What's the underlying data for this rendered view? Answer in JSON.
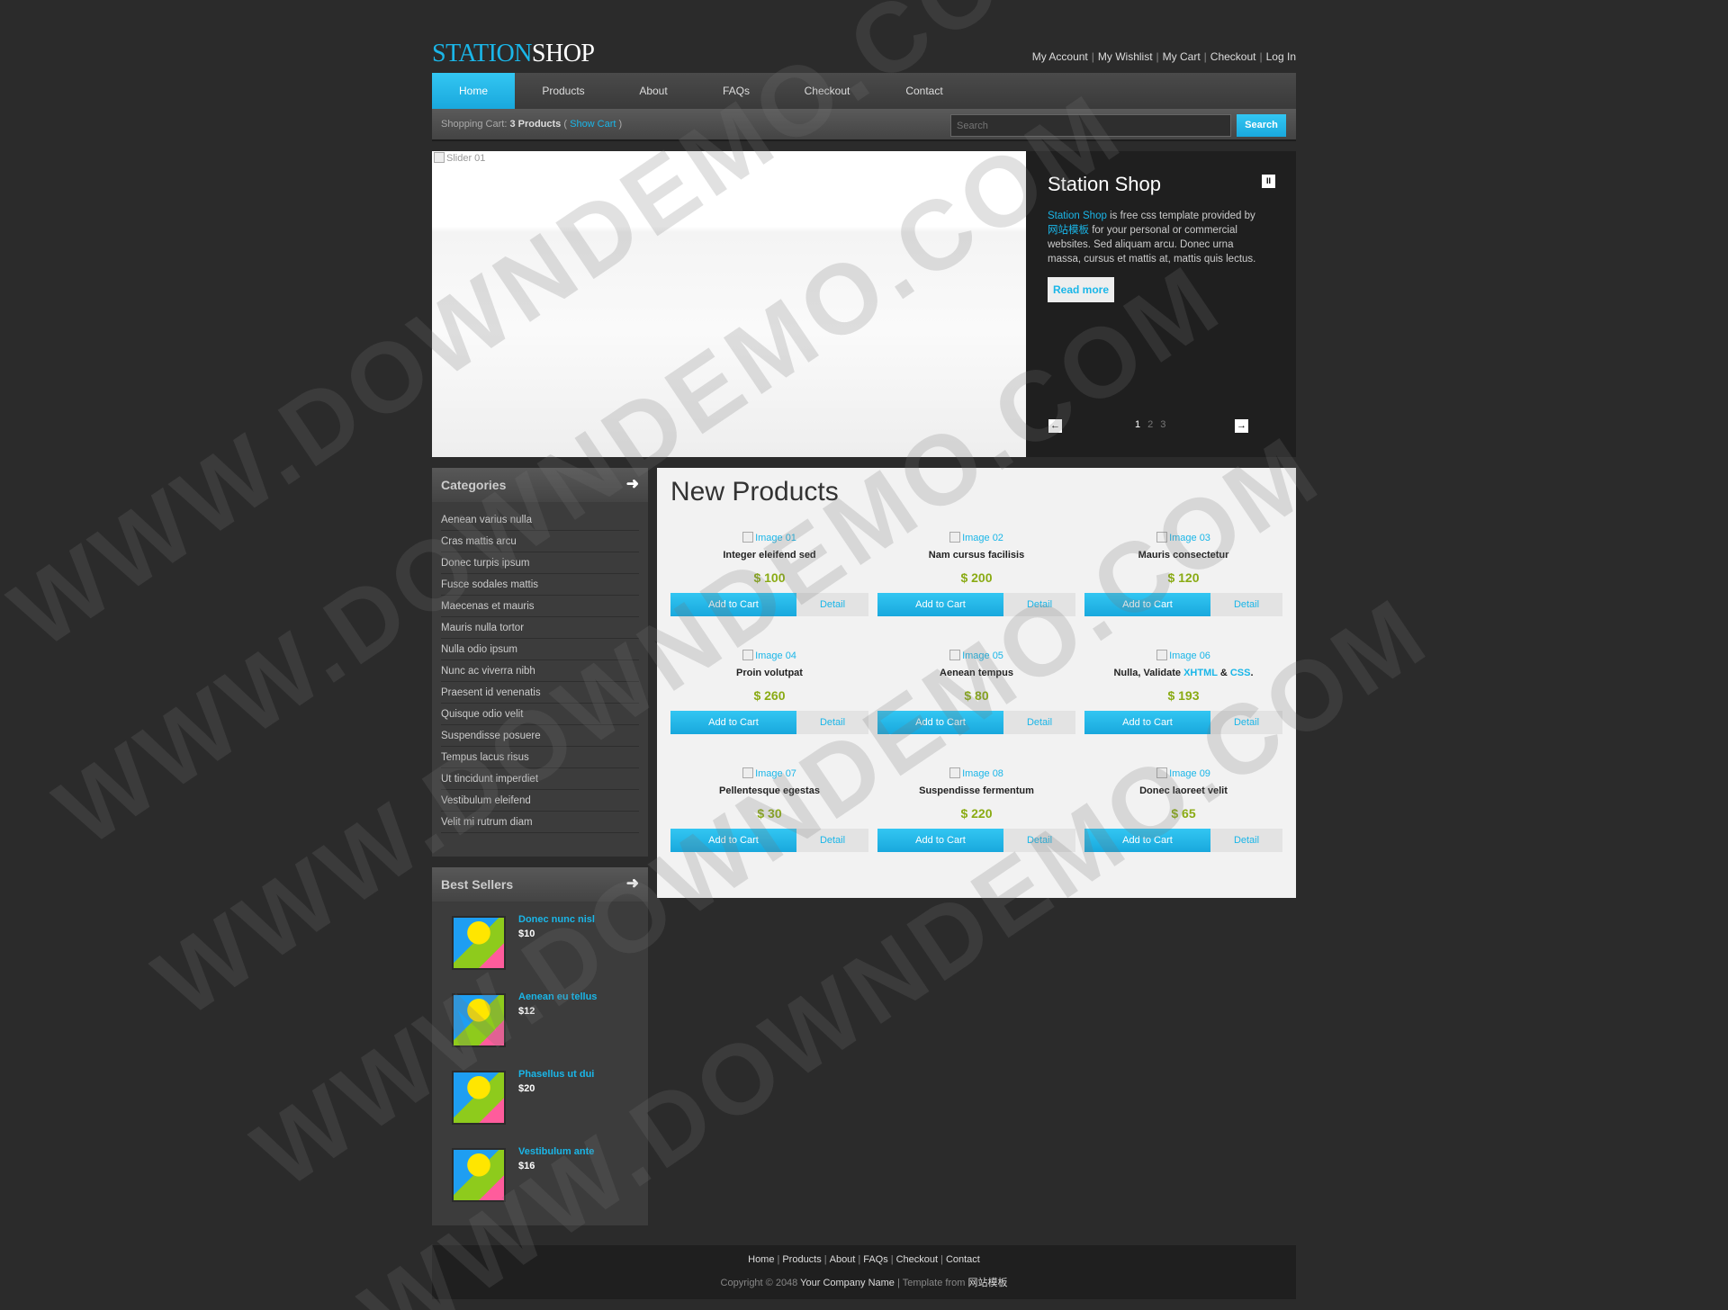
{
  "header": {
    "logo_part1": "STATION",
    "logo_part2": "SHOP",
    "top_links": [
      "My Account",
      "My Wishlist",
      "My Cart",
      "Checkout",
      "Log In"
    ]
  },
  "nav": {
    "items": [
      "Home",
      "Products",
      "About",
      "FAQs",
      "Checkout",
      "Contact"
    ],
    "active": "Home"
  },
  "cart_bar": {
    "label": "Shopping Cart:",
    "count": "3 Products",
    "open_paren": "(",
    "show_cart": "Show Cart",
    "close_paren": ")",
    "search_placeholder": "Search",
    "search_button": "Search"
  },
  "slider": {
    "image_alt": "Slider 01",
    "title": "Station Shop",
    "text_link": "Station Shop",
    "text_1": "is free css template provided by",
    "text_link2": "网站模板",
    "text_2": "for your personal or commercial websites. Sed aliquam arcu. Donec urna massa, cursus et mattis at, mattis quis lectus.",
    "read_more": "Read more",
    "pause_glyph": "II",
    "prev_glyph": "←",
    "next_glyph": "→",
    "pages": [
      "1",
      "2",
      "3"
    ],
    "current_page": "1"
  },
  "sidebar": {
    "categories_title": "Categories",
    "categories": [
      "Aenean varius nulla",
      "Cras mattis arcu",
      "Donec turpis ipsum",
      "Fusce sodales mattis",
      "Maecenas et mauris",
      "Mauris nulla tortor",
      "Nulla odio ipsum",
      "Nunc ac viverra nibh",
      "Praesent id venenatis",
      "Quisque odio velit",
      "Suspendisse posuere",
      "Tempus lacus risus",
      "Ut tincidunt imperdiet",
      "Vestibulum eleifend",
      "Velit mi rutrum diam"
    ],
    "bestsellers_title": "Best Sellers",
    "bestsellers": [
      {
        "name": "Donec nunc nisl",
        "price": "$10"
      },
      {
        "name": "Aenean eu tellus",
        "price": "$12"
      },
      {
        "name": "Phasellus ut dui",
        "price": "$20"
      },
      {
        "name": "Vestibulum ante",
        "price": "$16"
      }
    ],
    "arrow_glyph": "➜"
  },
  "main": {
    "title": "New Products",
    "add_label": "Add to Cart",
    "detail_label": "Detail",
    "products": [
      {
        "image": "Image 01",
        "name": "Integer eleifend sed",
        "price": "$ 100"
      },
      {
        "image": "Image 02",
        "name": "Nam cursus facilisis",
        "price": "$ 200"
      },
      {
        "image": "Image 03",
        "name": "Mauris consectetur",
        "price": "$ 120"
      },
      {
        "image": "Image 04",
        "name": "Proin volutpat",
        "price": "$ 260"
      },
      {
        "image": "Image 05",
        "name": "Aenean tempus",
        "price": "$ 80"
      },
      {
        "image": "Image 06",
        "name_parts": [
          "Nulla, Validate ",
          "XHTML",
          " & ",
          "CSS",
          "."
        ],
        "price": "$ 193"
      },
      {
        "image": "Image 07",
        "name": "Pellentesque egestas",
        "price": "$ 30"
      },
      {
        "image": "Image 08",
        "name": "Suspendisse fermentum",
        "price": "$ 220"
      },
      {
        "image": "Image 09",
        "name": "Donec laoreet velit",
        "price": "$ 65"
      }
    ]
  },
  "footer": {
    "links": [
      "Home",
      "Products",
      "About",
      "FAQs",
      "Checkout",
      "Contact"
    ],
    "copyright": "Copyright © 2048",
    "company": "Your Company Name",
    "separator": "|",
    "template_from": "Template from",
    "template_site": "网站模板"
  },
  "watermark": "WWW.DOWNDEMO.COM",
  "colors": {
    "accent": "#1ab6e8",
    "price": "#8aab14",
    "background": "#2b2b2b"
  }
}
